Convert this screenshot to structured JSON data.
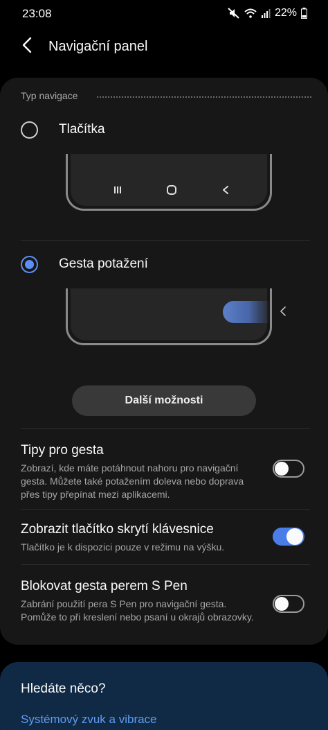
{
  "status": {
    "time": "23:08",
    "battery": "22%",
    "icons": [
      "mute-icon",
      "wifi-icon",
      "signal-icon",
      "battery-icon"
    ]
  },
  "header": {
    "title": "Navigační panel"
  },
  "navigation_type": {
    "section_label": "Typ navigace",
    "options": [
      {
        "label": "Tlačítka",
        "selected": false
      },
      {
        "label": "Gesta potažení",
        "selected": true
      }
    ],
    "more_button": "Další možnosti"
  },
  "settings": [
    {
      "title": "Tipy pro gesta",
      "desc": "Zobrazí, kde máte potáhnout nahoru pro navigační gesta. Můžete také potažením doleva nebo doprava přes tipy přepínat mezi aplikacemi.",
      "enabled": false
    },
    {
      "title": "Zobrazit tlačítko skrytí klávesnice",
      "desc": "Tlačítko je k dispozici pouze v režimu na výšku.",
      "enabled": true
    },
    {
      "title": "Blokovat gesta perem S Pen",
      "desc": "Zabrání použití pera S Pen pro navigační gesta. Pomůže to při kreslení nebo psaní u okrajů obrazovky.",
      "enabled": false
    }
  ],
  "search_card": {
    "title": "Hledáte něco?",
    "link": "Systémový zvuk a vibrace"
  },
  "colors": {
    "accent": "#5c8ef5",
    "toggle_on": "#4a7de8",
    "card_bg": "#171717",
    "search_card_bg": "#102a46",
    "link": "#5f9cf0"
  }
}
